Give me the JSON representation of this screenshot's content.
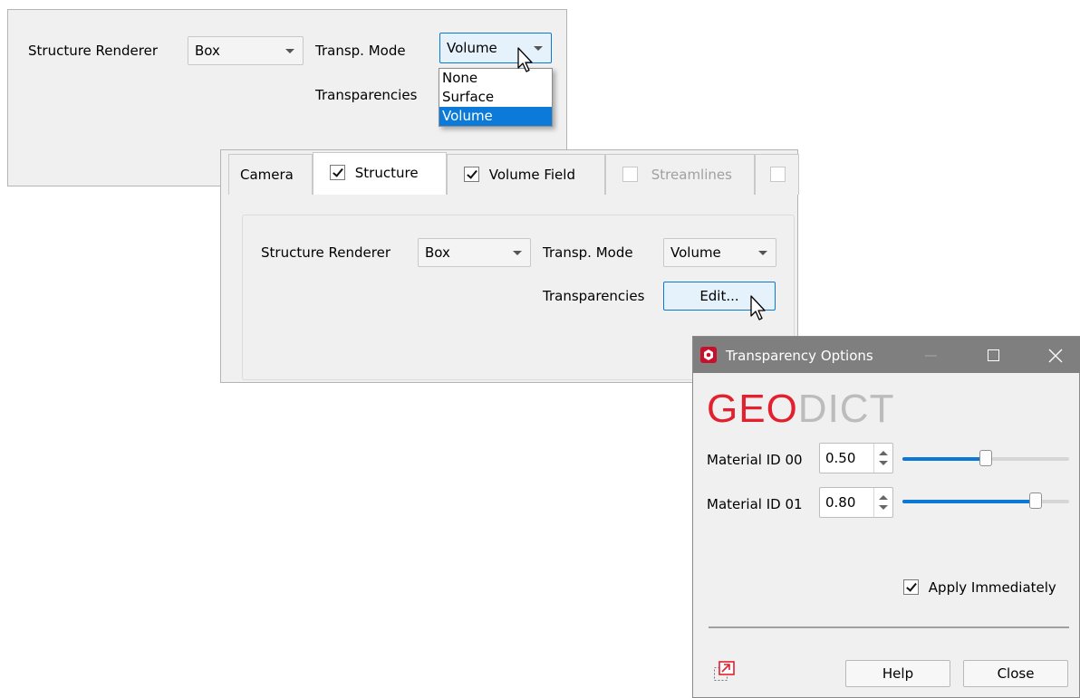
{
  "top_panel": {
    "structure_renderer_label": "Structure Renderer",
    "renderer_value": "Box",
    "transp_mode_label": "Transp. Mode",
    "transp_mode_value": "Volume",
    "transparencies_label": "Transparencies",
    "dropdown_options": [
      "None",
      "Surface",
      "Volume"
    ],
    "dropdown_selected": "Volume"
  },
  "tabs": [
    {
      "label": "Camera",
      "checkbox": null,
      "active": false,
      "enabled": true
    },
    {
      "label": "Structure",
      "checkbox": true,
      "active": true,
      "enabled": true
    },
    {
      "label": "Volume Field",
      "checkbox": true,
      "active": false,
      "enabled": true
    },
    {
      "label": "Streamlines",
      "checkbox": false,
      "active": false,
      "enabled": false
    },
    {
      "label": "",
      "checkbox": false,
      "active": false,
      "enabled": false
    }
  ],
  "structure_tab": {
    "structure_renderer_label": "Structure Renderer",
    "renderer_value": "Box",
    "transp_mode_label": "Transp. Mode",
    "transp_mode_value": "Volume",
    "transparencies_label": "Transparencies",
    "edit_button": "Edit..."
  },
  "dialog": {
    "title": "Transparency Options",
    "logo_geo": "GEO",
    "logo_dict": "DICT",
    "materials": [
      {
        "label": "Material ID 00",
        "value": "0.50",
        "fraction": 0.5
      },
      {
        "label": "Material ID 01",
        "value": "0.80",
        "fraction": 0.8
      }
    ],
    "apply_immediately_label": "Apply Immediately",
    "apply_immediately_checked": true,
    "help_button": "Help",
    "close_button": "Close"
  },
  "colors": {
    "accent": "#0b78d6",
    "logo_red": "#e3202d",
    "logo_gray": "#bcbcbc",
    "titlebar": "#7f7f7f",
    "dialog_icon": "#c8102e"
  },
  "icons": [
    "cursor-arrow-icon",
    "app-logo-icon",
    "minimize-icon",
    "maximize-icon",
    "close-icon",
    "undock-icon"
  ]
}
